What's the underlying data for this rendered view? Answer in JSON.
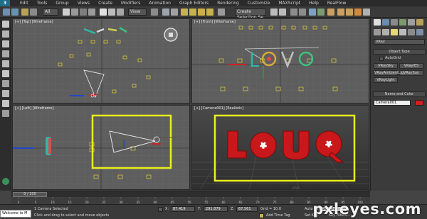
{
  "menu": {
    "logo": "3",
    "items": [
      "Edit",
      "Tools",
      "Group",
      "Views",
      "Create",
      "Modifiers",
      "Animation",
      "Graph Editors",
      "Rendering",
      "Customize",
      "MAXScript",
      "Help",
      "RealFlow"
    ]
  },
  "toolbar": {
    "filter_value": "All",
    "view_value": "View",
    "selection_set_value": "Create Selection Se"
  },
  "viewports": {
    "top": {
      "label": "[+] [Top] [Wireframe]"
    },
    "front": {
      "label": "[+] [Front] [Wireframe]"
    },
    "left": {
      "label": "[+] [Left] [Wireframe]"
    },
    "camera": {
      "label": "[+] [Camera001] [Realistic]",
      "word": "LOVQ"
    }
  },
  "command_panel": {
    "renderer_value": "VRay",
    "object_type": {
      "title": "Object Type",
      "autogrid": "AutoGrid",
      "buttons": [
        "VRaySky",
        "VRayIES",
        "VRaySun",
        "VRayAmbientLig",
        "VRayLight"
      ]
    },
    "name_color": {
      "title": "Name and Color",
      "name_value": "Camera001"
    },
    "swatch_color": "#d51e1e"
  },
  "timeslider": {
    "value": "0 / 100"
  },
  "trackbar": {
    "ticks": [
      "0",
      "5",
      "10",
      "15",
      "20",
      "25",
      "30",
      "35",
      "40",
      "45",
      "50",
      "55",
      "60",
      "65",
      "70",
      "75",
      "80",
      "85",
      "90",
      "95",
      "100"
    ]
  },
  "status": {
    "welcome": "Welcome to M",
    "selection": "1 Camera Selected",
    "prompt": "Click and drag to select and move objects",
    "x": "87.419",
    "y": "291.879",
    "z": "67.561",
    "grid": "Grid = 10.0",
    "add_time_tag": "Add Time Tag",
    "auto_key": "Auto Key",
    "set_key": "Set Key",
    "selected_value": "Selected",
    "key_filters": "Key Filters..."
  },
  "watermark": "pxleyes.com"
}
